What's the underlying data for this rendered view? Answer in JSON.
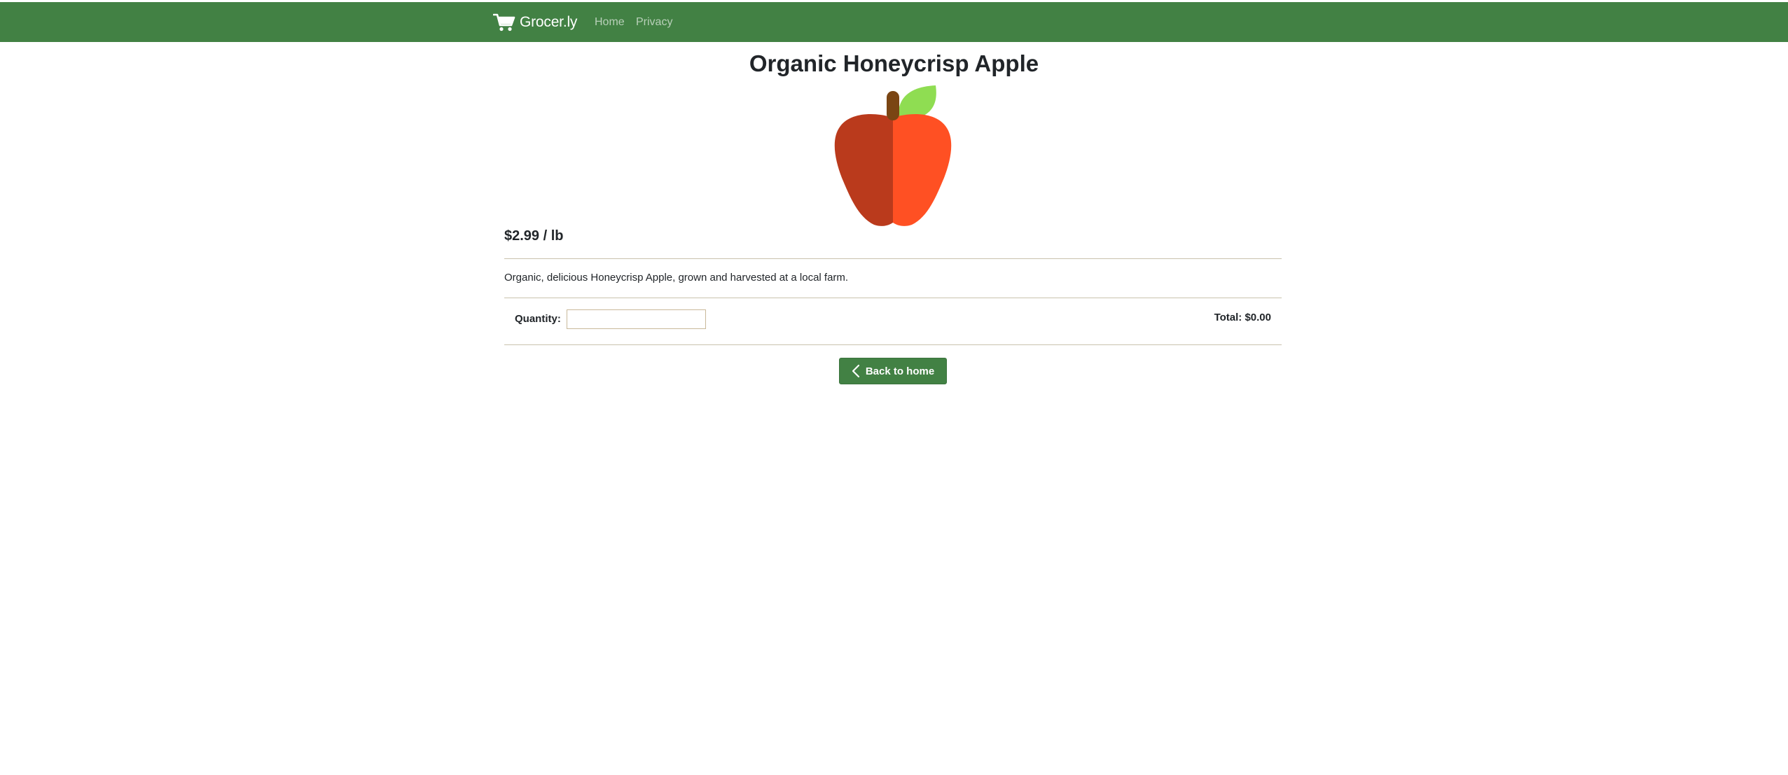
{
  "navbar": {
    "brand_icon": "cart-icon",
    "brand_name": "Grocer.ly",
    "links": [
      {
        "label": "Home"
      },
      {
        "label": "Privacy"
      }
    ],
    "background_color": "#428144"
  },
  "product": {
    "title": "Organic Honeycrisp Apple",
    "image_icon": "apple-icon",
    "price": "$2.99 / lb",
    "description": "Organic, delicious Honeycrisp Apple, grown and harvested at a local farm."
  },
  "order": {
    "quantity_label": "Quantity:",
    "quantity_value": "",
    "total": "Total: $0.00"
  },
  "actions": {
    "back_icon": "chevron-left-icon",
    "back_label": "Back to home"
  },
  "colors": {
    "accent": "#428144",
    "apple_dark": "#BA3A1C",
    "apple_light": "#FF5023",
    "leaf": "#8FDD52",
    "stem": "#7A4513"
  }
}
